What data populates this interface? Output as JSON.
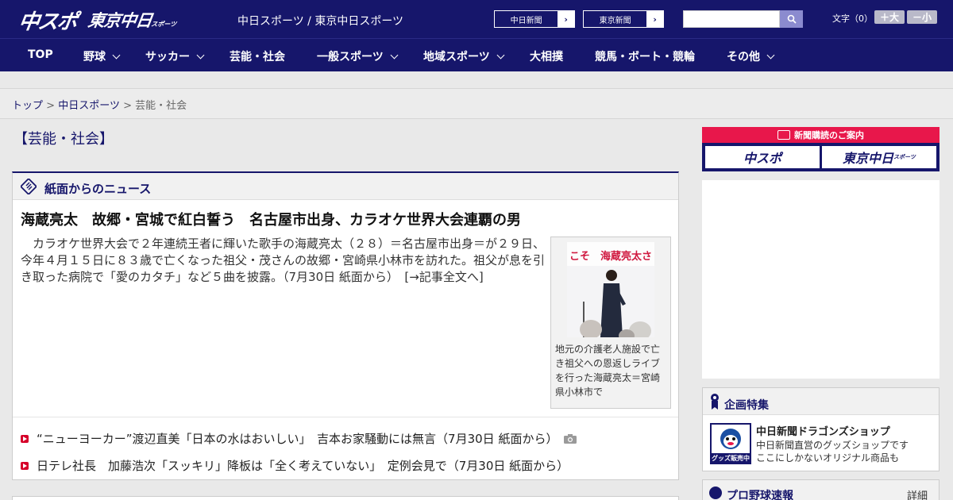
{
  "header": {
    "logo_chuspo": "中スポ",
    "logo_tokyo": "東京中日",
    "logo_tokyo_sub": "スポーツ",
    "site_title": "中日スポーツ / 東京中日スポーツ",
    "buttons": [
      {
        "label": "中日新聞",
        "arrow": "›"
      },
      {
        "label": "東京新聞",
        "arrow": "›"
      }
    ],
    "search": {
      "placeholder": "",
      "icon": "search-icon"
    },
    "font_size_label": "文字（0）",
    "font_larger": "＋大",
    "font_smaller": "－小"
  },
  "nav": {
    "items": [
      {
        "label": "TOP",
        "dropdown": false
      },
      {
        "label": "野球",
        "dropdown": true
      },
      {
        "label": "サッカー",
        "dropdown": true
      },
      {
        "label": "芸能・社会",
        "dropdown": false
      },
      {
        "label": "一般スポーツ",
        "dropdown": true
      },
      {
        "label": "地域スポーツ",
        "dropdown": true
      },
      {
        "label": "大相撲",
        "dropdown": false
      },
      {
        "label": "競馬・ボート・競輪",
        "dropdown": false
      },
      {
        "label": "その他",
        "dropdown": true
      }
    ]
  },
  "breadcrumb": {
    "items": [
      "トップ",
      "中日スポーツ",
      "芸能・社会"
    ],
    "separator": ">"
  },
  "main": {
    "page_heading": "【芸能・社会】",
    "news_box": {
      "title": "紙面からのニュース",
      "headline": "海蔵亮太　故郷・宮城で紅白誓う　名古屋市出身、カラオケ世界大会連覇の男",
      "lead": "　カラオケ世界大会で２年連続王者に輝いた歌手の海蔵亮太（２８）＝名古屋市出身＝が２９日、今年４月１５日に８３歳で亡くなった祖父・茂さんの故郷・宮崎県小林市を訪れた。祖父が息を引き取った病院で「愛のカタチ」など５曲を披露。（7月30日 紙面から）",
      "lead_more": "[→記事全文へ]",
      "photo_banner": "こそ　海蔵亮太さ",
      "photo_caption": "地元の介護老人施設で亡き祖父への恩返しライブを行った海蔵亮太＝宮崎県小林市で",
      "list": [
        {
          "text": "“ニューヨーカー”渡辺直美「日本の水はおいしい」　吉本お家騒動には無言",
          "date": "（7月30日 紙面から）",
          "has_photo": true
        },
        {
          "text": "日テレ社長　加藤浩次「スッキリ」降板は「全く考えていない」　定例会見で",
          "date": "（7月30日 紙面から）",
          "has_photo": false
        }
      ]
    }
  },
  "sidebar": {
    "subscription": {
      "title": "新聞購読のご案内",
      "btn1": "中スポ",
      "btn2": "東京中日",
      "btn2_sub": "スポーツ"
    },
    "planning": {
      "title": "企画特集",
      "shop_name": "中日新聞ドラゴンズショップ",
      "shop_desc_1": "中日新聞直営のグッズショップです",
      "shop_desc_2": "ここにしかないオリジナル商品も",
      "shop_badge": "グッズ販売中"
    },
    "pro_baseball": {
      "title": "プロ野球速報",
      "detail": "詳細 >"
    }
  },
  "colors": {
    "navy": "#16166b",
    "accent_red": "#e8174b",
    "bullet_red": "#d6002a",
    "background": "#e9e9e9"
  }
}
